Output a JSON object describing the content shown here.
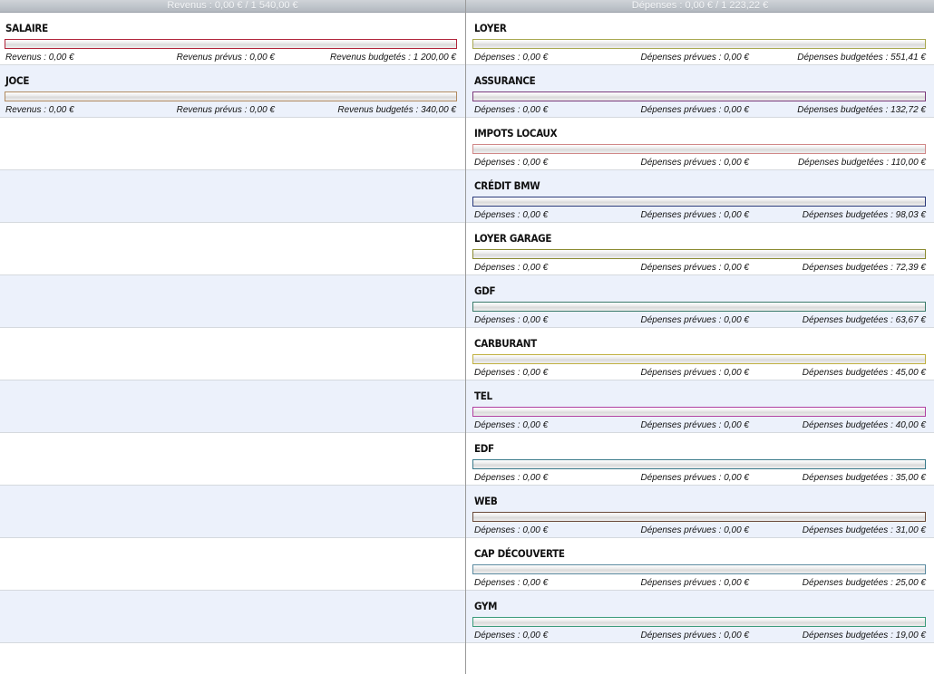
{
  "revenus": {
    "header": "Revenus : 0,00 € / 1 540,00 €",
    "items": [
      {
        "name": "SALAIRE",
        "actual": "Revenus : 0,00 €",
        "planned": "Revenus prévus : 0,00 €",
        "budget": "Revenus budgetés : 1 200,00 €",
        "color": "#b0243a",
        "progress": 0
      },
      {
        "name": "JOCE",
        "actual": "Revenus : 0,00 €",
        "planned": "Revenus prévus : 0,00 €",
        "budget": "Revenus budgetés : 340,00 €",
        "color": "#b08a60",
        "progress": 0
      }
    ],
    "empty_rows": 10
  },
  "depenses": {
    "header": "Dépenses : 0,00 € / 1 223,22 €",
    "items": [
      {
        "name": "LOYER",
        "actual": "Dépenses : 0,00 €",
        "planned": "Dépenses prévues : 0,00 €",
        "budget": "Dépenses budgetées : 551,41 €",
        "color": "#a8a850",
        "progress": 0
      },
      {
        "name": "ASSURANCE",
        "actual": "Dépenses : 0,00 €",
        "planned": "Dépenses prévues : 0,00 €",
        "budget": "Dépenses budgetées : 132,72 €",
        "color": "#7a3a7a",
        "progress": 0
      },
      {
        "name": "IMPOTS LOCAUX",
        "actual": "Dépenses : 0,00 €",
        "planned": "Dépenses prévues : 0,00 €",
        "budget": "Dépenses budgetées : 110,00 €",
        "color": "#d08888",
        "progress": 0
      },
      {
        "name": "CRÉDIT BMW",
        "actual": "Dépenses : 0,00 €",
        "planned": "Dépenses prévues : 0,00 €",
        "budget": "Dépenses budgetées : 98,03 €",
        "color": "#2a3a7a",
        "progress": 0
      },
      {
        "name": "LOYER GARAGE",
        "actual": "Dépenses : 0,00 €",
        "planned": "Dépenses prévues : 0,00 €",
        "budget": "Dépenses budgetées : 72,39 €",
        "color": "#8a8a30",
        "progress": 0
      },
      {
        "name": "GDF",
        "actual": "Dépenses : 0,00 €",
        "planned": "Dépenses prévues : 0,00 €",
        "budget": "Dépenses budgetées : 63,67 €",
        "color": "#3a7a6a",
        "progress": 0
      },
      {
        "name": "CARBURANT",
        "actual": "Dépenses : 0,00 €",
        "planned": "Dépenses prévues : 0,00 €",
        "budget": "Dépenses budgetées : 45,00 €",
        "color": "#c0b040",
        "progress": 0
      },
      {
        "name": "TEL",
        "actual": "Dépenses : 0,00 €",
        "planned": "Dépenses prévues : 0,00 €",
        "budget": "Dépenses budgetées : 40,00 €",
        "color": "#b040a0",
        "progress": 0
      },
      {
        "name": "EDF",
        "actual": "Dépenses : 0,00 €",
        "planned": "Dépenses prévues : 0,00 €",
        "budget": "Dépenses budgetées : 35,00 €",
        "color": "#3a7a8a",
        "progress": 0
      },
      {
        "name": "WEB",
        "actual": "Dépenses : 0,00 €",
        "planned": "Dépenses prévues : 0,00 €",
        "budget": "Dépenses budgetées : 31,00 €",
        "color": "#6a4a3a",
        "progress": 0
      },
      {
        "name": "CAP DÉCOUVERTE",
        "actual": "Dépenses : 0,00 €",
        "planned": "Dépenses prévues : 0,00 €",
        "budget": "Dépenses budgetées : 25,00 €",
        "color": "#5a8aa0",
        "progress": 0
      },
      {
        "name": "GYM",
        "actual": "Dépenses : 0,00 €",
        "planned": "Dépenses prévues : 0,00 €",
        "budget": "Dépenses budgetées : 19,00 €",
        "color": "#3a9a7a",
        "progress": 0
      }
    ],
    "empty_rows": 0
  }
}
